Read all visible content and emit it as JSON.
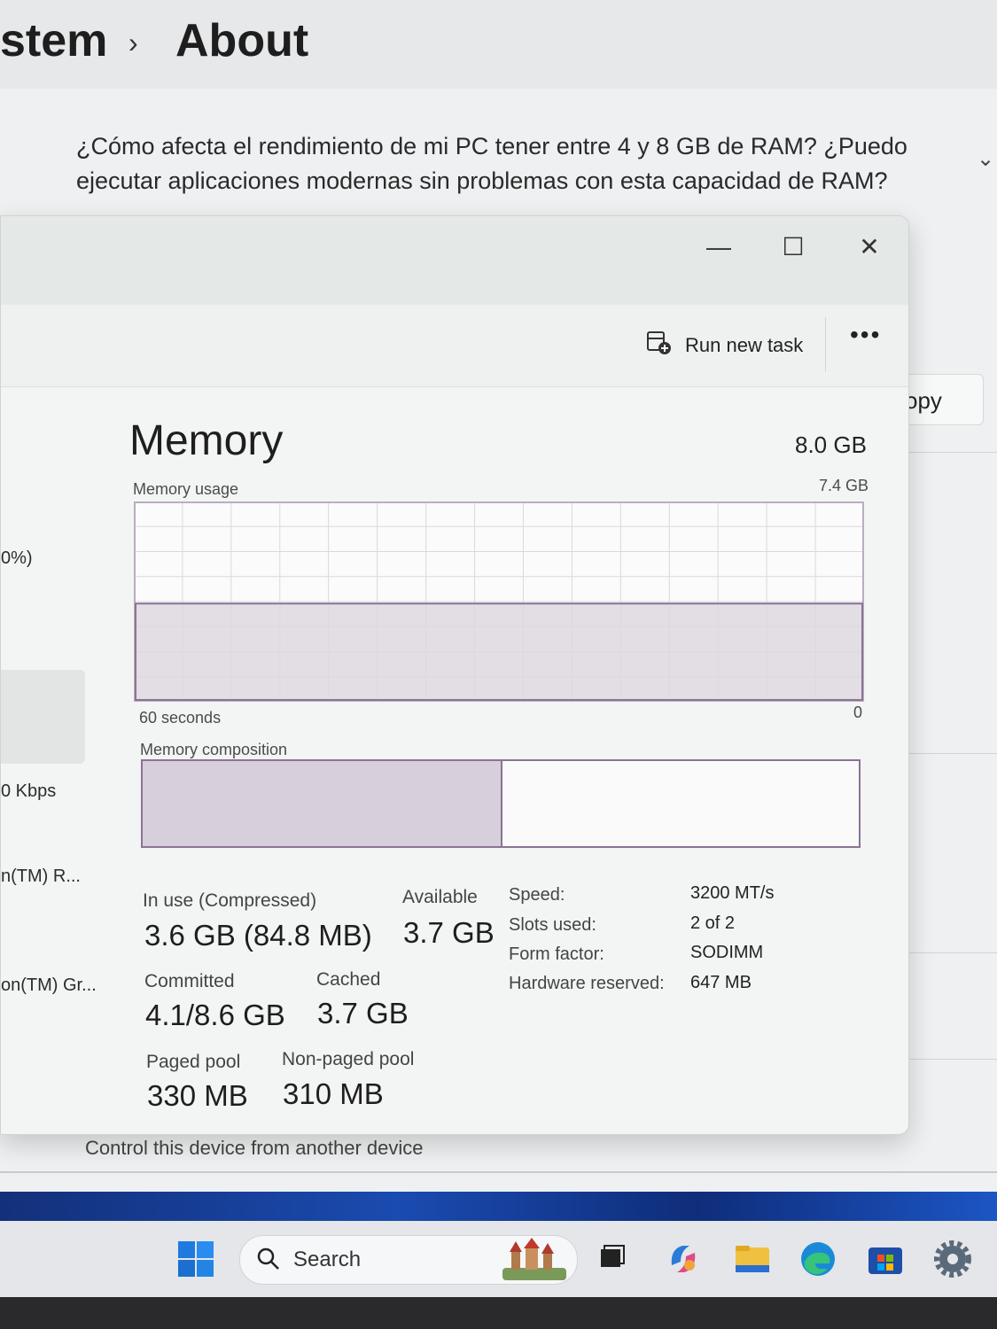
{
  "settings": {
    "breadcrumb_parent": "stem",
    "breadcrumb_sep": "›",
    "breadcrumb_current": "About",
    "question": "¿Cómo afecta el rendimiento de mi PC tener entre 4 y 8 GB de RAM? ¿Puedo ejecutar aplicaciones modernas sin problemas con esta capacidad de RAM?",
    "copy_label": "opy",
    "footer_link": "Control this device from another device"
  },
  "window": {
    "minimize": "—",
    "maximize": "☐",
    "close": "✕"
  },
  "toolbar": {
    "run_new_task": "Run new task",
    "more": "•••"
  },
  "left_pane": {
    "item_percent": "0%)",
    "item_kbps": "0 Kbps",
    "item_cpu": "n(TM) R...",
    "item_gpu": "on(TM) Gr..."
  },
  "memory": {
    "title": "Memory",
    "total": "8.0 GB",
    "usage_label": "Memory usage",
    "usage_max": "7.4 GB",
    "time_label": "60 seconds",
    "time_zero": "0",
    "composition_label": "Memory composition",
    "in_use_fraction": 0.5,
    "usage_level_fraction": 0.49
  },
  "stats": {
    "in_use_label": "In use (Compressed)",
    "in_use_value": "3.6 GB (84.8 MB)",
    "available_label": "Available",
    "available_value": "3.7 GB",
    "committed_label": "Committed",
    "committed_value": "4.1/8.6 GB",
    "cached_label": "Cached",
    "cached_value": "3.7 GB",
    "paged_label": "Paged pool",
    "paged_value": "330 MB",
    "nonpaged_label": "Non-paged pool",
    "nonpaged_value": "310 MB"
  },
  "specs": {
    "speed_key": "Speed:",
    "speed_val": "3200 MT/s",
    "slots_key": "Slots used:",
    "slots_val": "2 of 2",
    "form_key": "Form factor:",
    "form_val": "SODIMM",
    "hw_key": "Hardware reserved:",
    "hw_val": "647 MB"
  },
  "taskbar": {
    "search_placeholder": "Search",
    "icons": [
      "windows-start-icon",
      "search-icon",
      "castle-widget-icon",
      "task-view-icon",
      "copilot-icon",
      "file-explorer-icon",
      "edge-icon",
      "store-icon",
      "settings-gear-icon"
    ]
  },
  "colors": {
    "memory_accent": "#8a7494",
    "memory_fill": "#d7cfdb",
    "taskbar_wallpaper": "#1a4bb0"
  }
}
